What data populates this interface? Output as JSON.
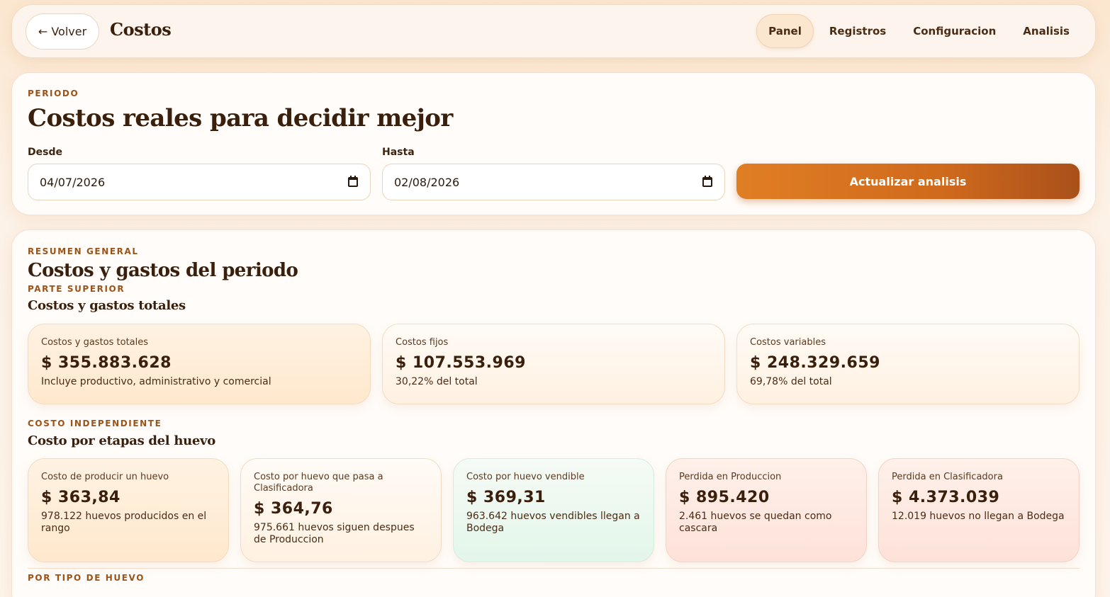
{
  "topbar": {
    "back_label": "← Volver",
    "brand": "Costos",
    "nav": [
      {
        "label": "Panel",
        "active": true
      },
      {
        "label": "Registros",
        "active": false
      },
      {
        "label": "Configuracion",
        "active": false
      },
      {
        "label": "Analisis",
        "active": false
      }
    ]
  },
  "period": {
    "kicker": "PERIODO",
    "title": "Costos reales para decidir mejor",
    "from_label": "Desde",
    "from_value": "04/07/2026",
    "to_label": "Hasta",
    "to_value": "02/08/2026",
    "action_label": "Actualizar analisis"
  },
  "summary": {
    "kicker": "RESUMEN GENERAL",
    "title": "Costos y gastos del periodo",
    "top_kicker": "PARTE SUPERIOR",
    "top_title": "Costos y gastos totales",
    "totals": [
      {
        "label": "Costos y gastos totales",
        "value": "$ 355.883.628",
        "sub": "Incluye productivo, administrativo y comercial"
      },
      {
        "label": "Costos fijos",
        "value": "$ 107.553.969",
        "sub": "30,22% del total"
      },
      {
        "label": "Costos variables",
        "value": "$ 248.329.659",
        "sub": "69,78% del total"
      }
    ],
    "egg_kicker": "COSTO INDEPENDIENTE",
    "egg_title": "Costo por etapas del huevo",
    "stages": [
      {
        "label": "Costo de producir un huevo",
        "value": "$ 363,84",
        "sub": "978.122 huevos producidos en el rango"
      },
      {
        "label": "Costo por huevo que pasa a Clasificadora",
        "value": "$ 364,76",
        "sub": "975.661 huevos siguen despues de Produccion"
      },
      {
        "label": "Costo por huevo vendible",
        "value": "$ 369,31",
        "sub": "963.642 huevos vendibles llegan a Bodega"
      },
      {
        "label": "Perdida en Produccion",
        "value": "$ 895.420",
        "sub": "2.461 huevos se quedan como cascara"
      },
      {
        "label": "Perdida en Clasificadora",
        "value": "$ 4.373.039",
        "sub": "12.019 huevos no llegan a Bodega"
      }
    ],
    "type_kicker": "POR TIPO DE HUEVO"
  }
}
